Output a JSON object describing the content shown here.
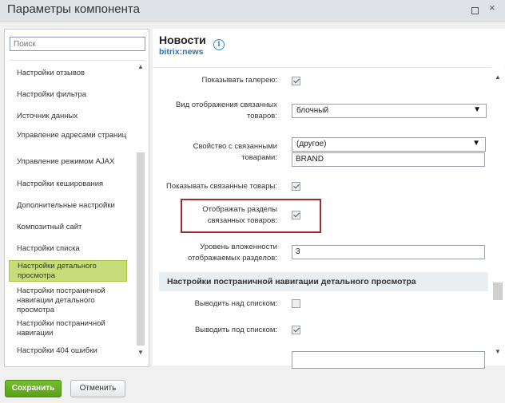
{
  "window": {
    "title": "Параметры компонента"
  },
  "search": {
    "placeholder": "Поиск"
  },
  "sidebar": {
    "items": [
      {
        "label": "Настройки отзывов"
      },
      {
        "label": "Настройки фильтра"
      },
      {
        "label": "Источник данных"
      },
      {
        "label": "Управление адресами страниц"
      },
      {
        "label": "Управление режимом AJAX"
      },
      {
        "label": "Настройки кеширования"
      },
      {
        "label": "Дополнительные настройки"
      },
      {
        "label": "Композитный сайт"
      },
      {
        "label": "Настройки списка"
      },
      {
        "label": "Настройки детального просмотра",
        "active": true
      },
      {
        "label": "Настройки постраничной навигации детального просмотра"
      },
      {
        "label": "Настройки постраничной навигации"
      },
      {
        "label": "Настройки 404 ошибки"
      }
    ]
  },
  "component": {
    "name": "Новости",
    "code": "bitrix:news"
  },
  "fields": {
    "show_gallery": {
      "label": "Показывать галерею:",
      "checked": true
    },
    "related_view": {
      "label": "Вид отображения связанных товаров:",
      "value": "блочный"
    },
    "related_property": {
      "label": "Свойство с связанными товарами:",
      "value": "(другое)",
      "input_value": "BRAND"
    },
    "show_related": {
      "label": "Показывать связанные товары:",
      "checked": true
    },
    "show_related_sections": {
      "label": "Отображать разделы связанных товаров:",
      "checked": true
    },
    "section_depth": {
      "label": "Уровень вложенности отображаемых разделов:",
      "value": "3"
    },
    "section_title": "Настройки постраничной навигации детального просмотра",
    "show_above_list": {
      "label": "Выводить над списком:",
      "checked": false
    },
    "show_below_list": {
      "label": "Выводить под списком:",
      "checked": true
    }
  },
  "footer": {
    "save_label": "Сохранить",
    "cancel_label": "Отменить"
  }
}
